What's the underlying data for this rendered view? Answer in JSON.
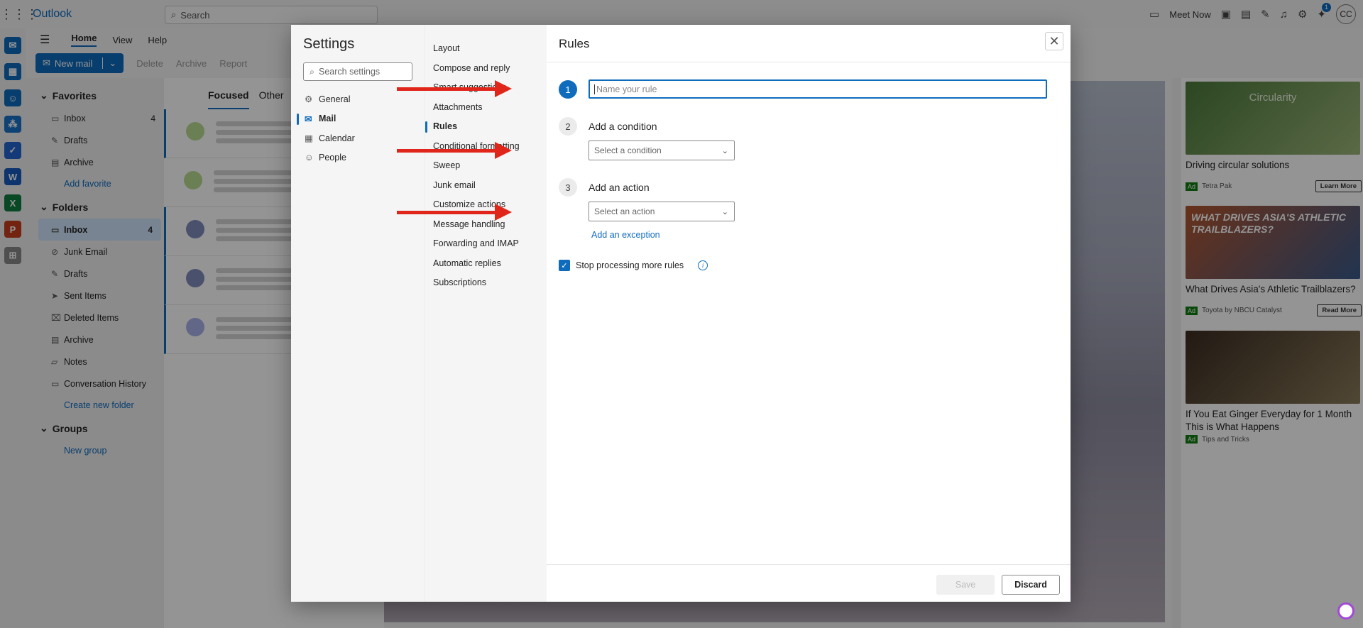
{
  "app": {
    "name": "Outlook",
    "search_placeholder": "Search",
    "meet_now": "Meet Now",
    "notification_count": "1",
    "avatar_initials": "CC"
  },
  "ribbon": {
    "tabs": [
      "Home",
      "View",
      "Help"
    ],
    "active_tab": "Home",
    "new_mail": "New mail",
    "actions": [
      "Delete",
      "Archive",
      "Report"
    ]
  },
  "folders": {
    "favorites_label": "Favorites",
    "favorites": [
      {
        "label": "Inbox",
        "count": "4"
      },
      {
        "label": "Drafts",
        "count": ""
      },
      {
        "label": "Archive",
        "count": ""
      }
    ],
    "add_favorite": "Add favorite",
    "folders_label": "Folders",
    "items": [
      {
        "label": "Inbox",
        "count": "4"
      },
      {
        "label": "Junk Email",
        "count": ""
      },
      {
        "label": "Drafts",
        "count": ""
      },
      {
        "label": "Sent Items",
        "count": ""
      },
      {
        "label": "Deleted Items",
        "count": ""
      },
      {
        "label": "Archive",
        "count": ""
      },
      {
        "label": "Notes",
        "count": ""
      },
      {
        "label": "Conversation History",
        "count": ""
      }
    ],
    "create_folder": "Create new folder",
    "groups_label": "Groups",
    "new_group": "New group"
  },
  "message_list": {
    "tabs": [
      "Focused",
      "Other"
    ]
  },
  "ads": [
    {
      "title": "Driving circular solutions",
      "advertiser": "Tetra Pak",
      "cta": "Learn More",
      "image_text": "Circularity"
    },
    {
      "title": "What Drives Asia's Athletic Trailblazers?",
      "advertiser": "Toyota by NBCU Catalyst",
      "cta": "Read More",
      "image_text": "WHAT DRIVES ASIA'S ATHLETIC TRAILBLAZERS?"
    },
    {
      "title": "If You Eat Ginger Everyday for 1 Month This is What Happens",
      "advertiser": "Tips and Tricks",
      "cta": ""
    }
  ],
  "ad_badge": "Ad",
  "settings": {
    "title": "Settings",
    "search_placeholder": "Search settings",
    "categories": [
      "General",
      "Mail",
      "Calendar",
      "People"
    ],
    "selected_category": "Mail",
    "subcategories": [
      "Layout",
      "Compose and reply",
      "Smart suggestions",
      "Attachments",
      "Rules",
      "Conditional formatting",
      "Sweep",
      "Junk email",
      "Customize actions",
      "Message handling",
      "Forwarding and IMAP",
      "Automatic replies",
      "Subscriptions"
    ],
    "selected_subcategory": "Rules",
    "panel": {
      "title": "Rules",
      "step1_number": "1",
      "rule_name_placeholder": "Name your rule",
      "step2_number": "2",
      "step2_label": "Add a condition",
      "condition_placeholder": "Select a condition",
      "step3_number": "3",
      "step3_label": "Add an action",
      "action_placeholder": "Select an action",
      "add_exception": "Add an exception",
      "stop_processing": "Stop processing more rules",
      "save": "Save",
      "discard": "Discard"
    }
  },
  "colors": {
    "accent": "#0f6cbd",
    "annotation_arrow": "#e0261b"
  }
}
